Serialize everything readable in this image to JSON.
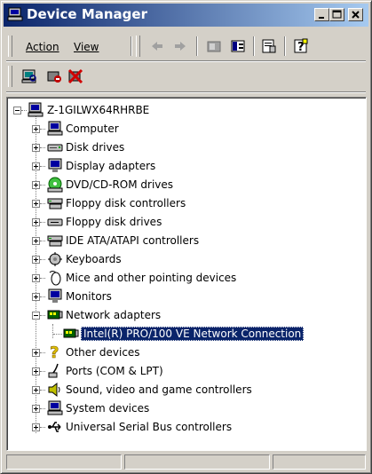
{
  "window": {
    "title": "Device Manager",
    "controls": [
      "minimize",
      "maximize",
      "close"
    ]
  },
  "menu": {
    "action_label": "Action",
    "view_label": "View"
  },
  "toolbar": {
    "icons": [
      "back-icon",
      "forward-icon",
      "folder-properties-icon",
      "show-hide-icon",
      "properties-icon",
      "help-icon"
    ]
  },
  "toolbar2": {
    "icons": [
      "scan-hardware-icon",
      "disable-device-icon",
      "uninstall-device-icon"
    ]
  },
  "tree": {
    "root": "Z-1GILWX64RHRBE",
    "categories": [
      {
        "label": "Computer",
        "icon": "computer-icon",
        "expanded": false
      },
      {
        "label": "Disk drives",
        "icon": "disk-drive-icon",
        "expanded": false
      },
      {
        "label": "Display adapters",
        "icon": "monitor-icon",
        "expanded": false
      },
      {
        "label": "DVD/CD-ROM drives",
        "icon": "cdrom-icon",
        "expanded": false
      },
      {
        "label": "Floppy disk controllers",
        "icon": "controller-icon",
        "expanded": false
      },
      {
        "label": "Floppy disk drives",
        "icon": "floppy-icon",
        "expanded": false
      },
      {
        "label": "IDE ATA/ATAPI controllers",
        "icon": "controller-icon",
        "expanded": false
      },
      {
        "label": "Keyboards",
        "icon": "keyboard-icon",
        "expanded": false
      },
      {
        "label": "Mice and other pointing devices",
        "icon": "mouse-icon",
        "expanded": false
      },
      {
        "label": "Monitors",
        "icon": "monitor-icon",
        "expanded": false
      },
      {
        "label": "Network adapters",
        "icon": "network-card-icon",
        "expanded": true
      },
      {
        "label": "Other devices",
        "icon": "question-icon",
        "expanded": false
      },
      {
        "label": "Ports (COM & LPT)",
        "icon": "port-icon",
        "expanded": false
      },
      {
        "label": "Sound, video and game controllers",
        "icon": "speaker-icon",
        "expanded": false
      },
      {
        "label": "System devices",
        "icon": "computer-icon",
        "expanded": false
      },
      {
        "label": "Universal Serial Bus controllers",
        "icon": "usb-icon",
        "expanded": false
      }
    ],
    "network_child": "Intel(R) PRO/100 VE Network Connection"
  },
  "colors": {
    "title_start": "#0a246a",
    "title_end": "#a6caf0",
    "selection": "#0a246a",
    "chrome": "#d4d0c8"
  }
}
